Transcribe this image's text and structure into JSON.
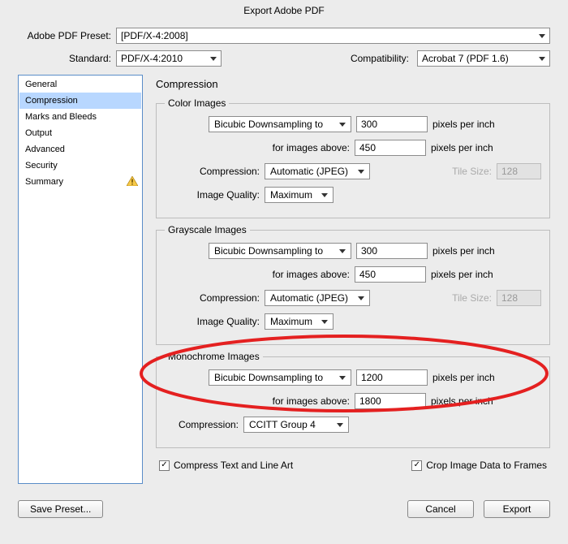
{
  "window": {
    "title": "Export Adobe PDF"
  },
  "top": {
    "preset_label": "Adobe PDF Preset:",
    "preset_value": "[PDF/X-4:2008]",
    "standard_label": "Standard:",
    "standard_value": "PDF/X-4:2010",
    "compat_label": "Compatibility:",
    "compat_value": "Acrobat 7 (PDF 1.6)"
  },
  "sidebar": {
    "items": [
      {
        "label": "General",
        "selected": false
      },
      {
        "label": "Compression",
        "selected": true
      },
      {
        "label": "Marks and Bleeds",
        "selected": false
      },
      {
        "label": "Output",
        "selected": false
      },
      {
        "label": "Advanced",
        "selected": false
      },
      {
        "label": "Security",
        "selected": false
      },
      {
        "label": "Summary",
        "selected": false,
        "warning": true
      }
    ]
  },
  "panel": {
    "title": "Compression",
    "color": {
      "legend": "Color Images",
      "method": "Bicubic Downsampling to",
      "ppi": "300",
      "ppi_unit": "pixels per inch",
      "above_label": "for images above:",
      "above": "450",
      "compression_label": "Compression:",
      "compression": "Automatic (JPEG)",
      "tilesize_label": "Tile Size:",
      "tilesize": "128",
      "quality_label": "Image Quality:",
      "quality": "Maximum"
    },
    "gray": {
      "legend": "Grayscale Images",
      "method": "Bicubic Downsampling to",
      "ppi": "300",
      "ppi_unit": "pixels per inch",
      "above_label": "for images above:",
      "above": "450",
      "compression_label": "Compression:",
      "compression": "Automatic (JPEG)",
      "tilesize_label": "Tile Size:",
      "tilesize": "128",
      "quality_label": "Image Quality:",
      "quality": "Maximum"
    },
    "mono": {
      "legend": "Monochrome Images",
      "method": "Bicubic Downsampling to",
      "ppi": "1200",
      "ppi_unit": "pixels per inch",
      "above_label": "for images above:",
      "above": "1800",
      "compression_label": "Compression:",
      "compression": "CCITT Group 4"
    },
    "checks": {
      "compress_text": "Compress Text and Line Art",
      "crop_image": "Crop Image Data to Frames"
    }
  },
  "buttons": {
    "save_preset": "Save Preset...",
    "cancel": "Cancel",
    "export": "Export"
  },
  "icons": {
    "check": "✓"
  }
}
